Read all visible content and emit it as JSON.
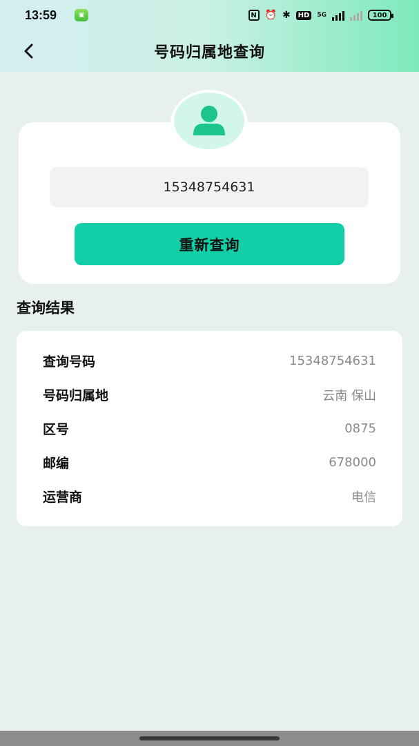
{
  "status_bar": {
    "time": "13:59",
    "battery": "100",
    "network": "5G",
    "hd_badge": "HD"
  },
  "nav": {
    "title": "号码归属地查询"
  },
  "search": {
    "phone_value": "15348754631",
    "button_label": "重新查询"
  },
  "results": {
    "section_title": "查询结果",
    "rows": [
      {
        "label": "查询号码",
        "value": "15348754631"
      },
      {
        "label": "号码归属地",
        "value": "云南 保山"
      },
      {
        "label": "区号",
        "value": "0875"
      },
      {
        "label": "邮编",
        "value": "678000"
      },
      {
        "label": "运营商",
        "value": "电信"
      }
    ]
  },
  "colors": {
    "accent": "#13cfa8",
    "avatar_icon": "#1ec48d",
    "background": "#e8f0ee"
  },
  "icons": {
    "back": "chevron-left-icon",
    "avatar": "user-icon",
    "nfc": "nfc-icon",
    "alarm": "alarm-icon",
    "bluetooth": "bluetooth-icon"
  }
}
